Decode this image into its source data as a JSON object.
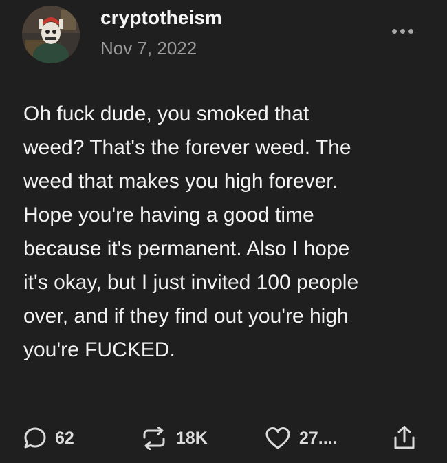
{
  "post": {
    "username": "cryptotheism",
    "date": "Nov 7, 2022",
    "body": "Oh fuck dude, you smoked that\nweed? That's the forever weed. The\nweed that makes you high forever.\nHope you're having a good time\nbecause it's permanent. Also I hope\nit's okay, but I just invited 100 people\nover, and if they find out you're high\nyou're FUCKED."
  },
  "actions": {
    "replies": {
      "icon": "speech-bubble-icon",
      "count": "62"
    },
    "reblogs": {
      "icon": "repost-arrows-icon",
      "count": "18K"
    },
    "likes": {
      "icon": "heart-icon",
      "count": "27...."
    },
    "share": {
      "icon": "share-upload-icon"
    }
  },
  "menu": {
    "icon": "more-dots-icon"
  },
  "colors": {
    "background": "#1f1f1f",
    "text": "#f2f2f2",
    "muted": "#9a9a9a",
    "icon": "#dcdcdc"
  }
}
